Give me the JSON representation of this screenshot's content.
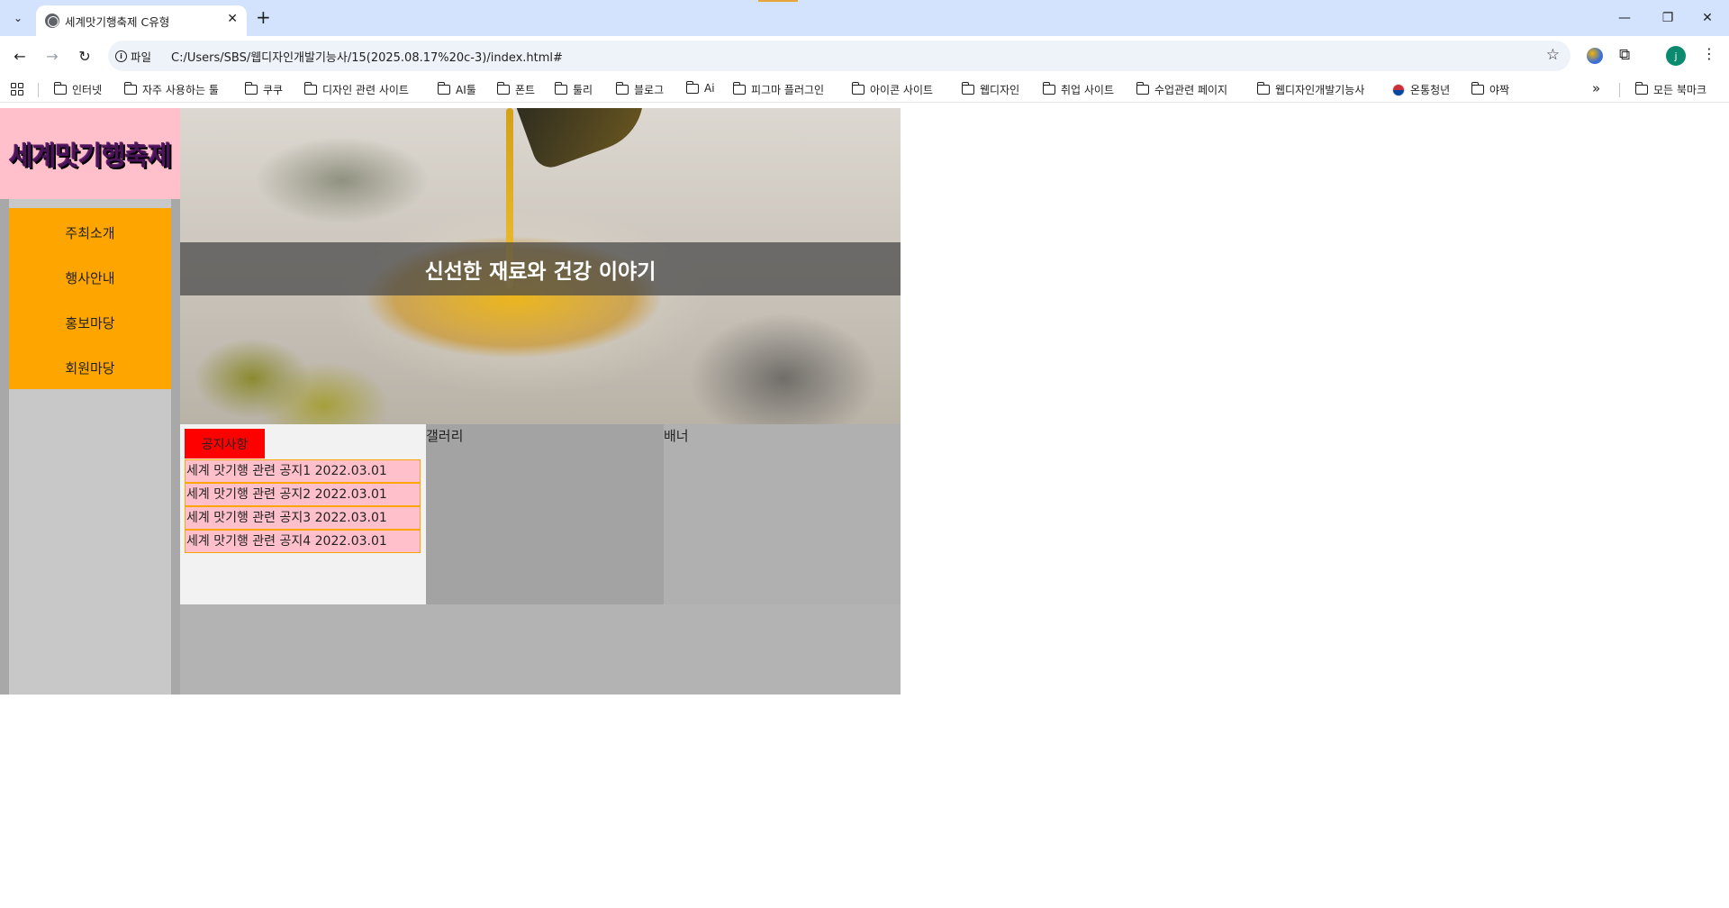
{
  "browser": {
    "tab_title": "세계맛기행축제 C유형",
    "tab_close": "✕",
    "new_tab": "+",
    "url_chip": "파일",
    "url": "C:/Users/SBS/웹디자인개발기능사/15(2025.08.17%20c-3)/index.html#",
    "avatar_letter": "j",
    "window_min": "—",
    "window_max": "❐",
    "window_close": "✕",
    "bookmarks": [
      {
        "label": "인터넷",
        "icon": "folder-icon"
      },
      {
        "label": "자주 사용하는 툴",
        "icon": "folder-icon"
      },
      {
        "label": "쿠쿠",
        "icon": "folder-icon"
      },
      {
        "label": "디자인 관련 사이트",
        "icon": "folder-icon"
      },
      {
        "label": "AI툴",
        "icon": "folder-icon"
      },
      {
        "label": "폰트",
        "icon": "folder-icon"
      },
      {
        "label": "툴리",
        "icon": "folder-icon"
      },
      {
        "label": "블로그",
        "icon": "folder-icon"
      },
      {
        "label": "Ai",
        "icon": "folder-icon"
      },
      {
        "label": "피그마 플러그인",
        "icon": "folder-icon"
      },
      {
        "label": "아이콘 사이트",
        "icon": "folder-icon"
      },
      {
        "label": "웹디자인",
        "icon": "folder-icon"
      },
      {
        "label": "취업 사이트",
        "icon": "folder-icon"
      },
      {
        "label": "수업관련 페이지",
        "icon": "folder-icon"
      },
      {
        "label": "웹디자인개발기능사",
        "icon": "folder-icon"
      },
      {
        "label": "온통청년",
        "icon": "flag-icon"
      },
      {
        "label": "야짝",
        "icon": "folder-icon"
      }
    ],
    "bookmarks_more": "»",
    "all_bookmarks": "모든 북마크"
  },
  "site": {
    "logo": "세계맛기행축제",
    "nav": [
      "주최소개",
      "행사안내",
      "홍보마당",
      "회원마당"
    ],
    "hero_text": "신선한 재료와 건강 이야기",
    "notice_tab": "공지사항",
    "notices": [
      "세계 맛기행 관련 공지1 2022.03.01",
      "세계 맛기행 관련 공지2 2022.03.01",
      "세계 맛기행 관련 공지3 2022.03.01",
      "세계 맛기행 관련 공지4 2022.03.01"
    ],
    "gallery_title": "갤러리",
    "banner_title": "배너"
  },
  "colors": {
    "logo_bg": "#ffc0cb",
    "nav_bg": "#ffa500",
    "notice_tab_bg": "#ff0000",
    "notice_row_bg": "#ffc0cb",
    "notice_row_border": "#ffa500"
  }
}
